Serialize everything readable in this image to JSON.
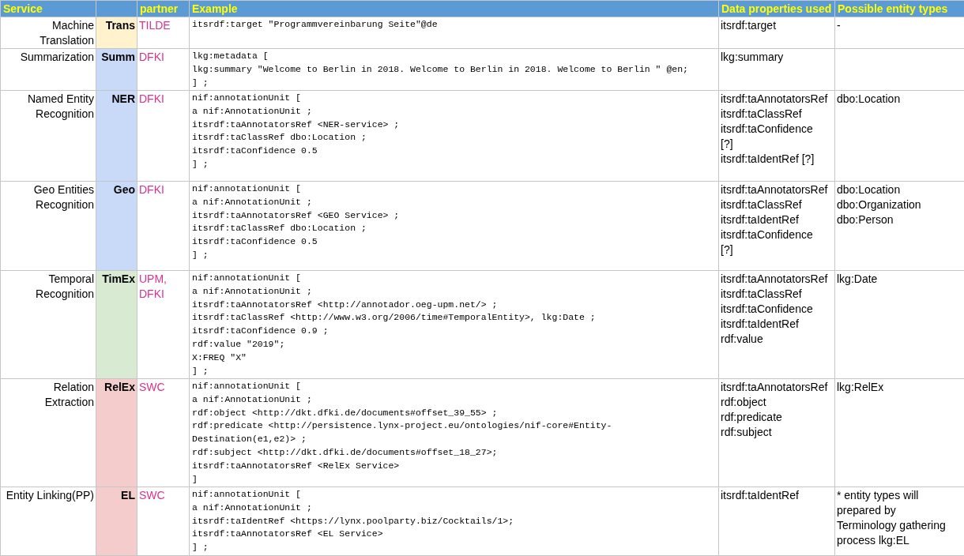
{
  "table": {
    "columns": [
      "Service",
      "partner",
      "Example",
      "Data properties used",
      "Possible entity types"
    ],
    "rows": [
      {
        "service": "Machine Translation",
        "code": "Trans",
        "color": "#fff2cc",
        "partner": "TILDE",
        "example": [
          "itsrdf:target \"Programmvereinbarung Seite\"@de"
        ],
        "data_properties": [
          "itsrdf:target"
        ],
        "entity_types": [
          "-"
        ]
      },
      {
        "service": "Summarization",
        "code": "Summ",
        "color": "#c9daf8",
        "partner": "DFKI",
        "example": [
          "lkg:metadata [",
          "lkg:summary \"Welcome to Berlin in 2018. Welcome to Berlin in 2018. Welcome to Berlin \" @en;",
          "] ;"
        ],
        "data_properties": [
          "lkg:summary"
        ],
        "entity_types": []
      },
      {
        "service": "Named Entity Recognition",
        "code": "NER",
        "color": "#c9daf8",
        "partner": "DFKI",
        "example": [
          "nif:annotationUnit [",
          "a nif:AnnotationUnit ;",
          "itsrdf:taAnnotatorsRef <NER-service> ;",
          "itsrdf:taClassRef dbo:Location ;",
          "itsrdf:taConfidence 0.5",
          "] ;"
        ],
        "data_properties": [
          "itsrdf:taAnnotatorsRef",
          "itsrdf:taClassRef",
          "itsrdf:taConfidence",
          "[?]",
          "itsrdf:taIdentRef [?]"
        ],
        "entity_types": [
          "dbo:Location"
        ]
      },
      {
        "service": "Geo Entities Recognition",
        "code": "Geo",
        "color": "#c9daf8",
        "partner": "DFKI",
        "example": [
          "nif:annotationUnit [",
          "a nif:AnnotationUnit ;",
          "itsrdf:taAnnotatorsRef <GEO Service> ;",
          "itsrdf:taClassRef dbo:Location ;",
          "itsrdf:taConfidence 0.5",
          "] ;"
        ],
        "data_properties": [
          "itsrdf:taAnnotatorsRef",
          "itsrdf:taClassRef",
          "itsrdf:taIdentRef",
          "itsrdf:taConfidence",
          "[?]"
        ],
        "entity_types": [
          "dbo:Location",
          "dbo:Organization",
          "dbo:Person"
        ]
      },
      {
        "service": "Temporal Recognition",
        "code": "TimEx",
        "color": "#d9ead3",
        "partner": "UPM, DFKI",
        "example": [
          "nif:annotationUnit [",
          "a nif:AnnotationUnit ;",
          "itsrdf:taAnnotatorsRef <http://annotador.oeg-upm.net/> ;",
          "itsrdf:taClassRef <http://www.w3.org/2006/time#TemporalEntity>, lkg:Date ;",
          "itsrdf:taConfidence 0.9 ;",
          "rdf:value \"2019\";",
          "X:FREQ \"X\"",
          "] ;"
        ],
        "data_properties": [
          "itsrdf:taAnnotatorsRef",
          "itsrdf:taClassRef",
          "itsrdf:taConfidence",
          "itsrdf:taIdentRef",
          "rdf:value"
        ],
        "entity_types": [
          "lkg:Date"
        ]
      },
      {
        "service": "Relation Extraction",
        "code": "RelEx",
        "color": "#f4cccc",
        "partner": "SWC",
        "example": [
          "nif:annotationUnit [",
          "a nif:AnnotationUnit ;",
          "rdf:object <http://dkt.dfki.de/documents#offset_39_55> ;",
          "rdf:predicate <http://persistence.lynx-project.eu/ontologies/nif-core#Entity-",
          "Destination(e1,e2)> ;",
          "rdf:subject <http://dkt.dfki.de/documents#offset_18_27>;",
          "itsrdf:taAnnotatorsRef <RelEx Service>",
          "]"
        ],
        "data_properties": [
          "itsrdf:taAnnotatorsRef",
          "rdf:object",
          "rdf:predicate",
          "rdf:subject"
        ],
        "entity_types": [
          "lkg:RelEx"
        ]
      },
      {
        "service": "Entity Linking(PP)",
        "code": "EL",
        "color": "#f4cccc",
        "partner": "SWC",
        "example": [
          "nif:annotationUnit [",
          "a nif:AnnotationUnit ;",
          "itsrdf:taIdentRef <https://lynx.poolparty.biz/Cocktails/1>;",
          "itsrdf:taAnnotatorsRef <EL Service>",
          "] ;"
        ],
        "data_properties": [
          "itsrdf:taIdentRef"
        ],
        "entity_types": [
          "* entity types will prepared by Terminology gathering process lkg:EL"
        ]
      }
    ]
  }
}
